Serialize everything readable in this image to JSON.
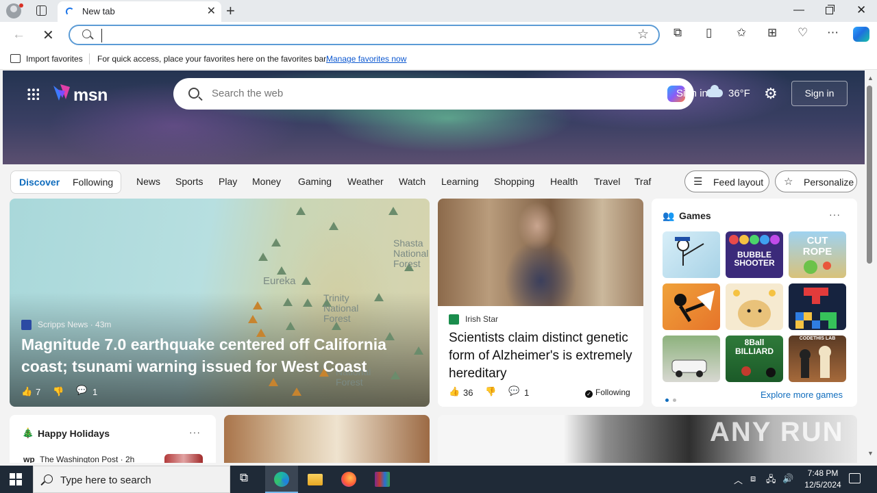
{
  "browser": {
    "tab_title": "New tab",
    "address_value": "",
    "favorites_bar": {
      "import_label": "Import favorites",
      "hint_text": "For quick access, place your favorites here on the favorites bar.",
      "manage_link": "Manage favorites now"
    }
  },
  "msn": {
    "logo_text": "msn",
    "search_placeholder": "Search the web",
    "signin_peek": "Sign in",
    "temperature": "36°F",
    "signin_button": "Sign in",
    "categories": {
      "discover": "Discover",
      "following": "Following",
      "items": [
        "News",
        "Sports",
        "Play",
        "Money",
        "Gaming",
        "Weather",
        "Watch",
        "Learning",
        "Shopping",
        "Health",
        "Travel",
        "Traf"
      ]
    },
    "feed_layout_label": "Feed layout",
    "personalize_label": "Personalize",
    "hero_story": {
      "source": "Scripps News · 43m",
      "title": "Magnitude 7.0 earthquake centered off California coast; tsunami warning issued for West Coast",
      "likes": "7",
      "comments": "1",
      "map_labels": [
        "Eureka",
        "Shasta\nNational\nForest",
        "Trinity\nNational\nForest",
        "National\nForest"
      ]
    },
    "second_story": {
      "source": "Irish Star",
      "title": "Scientists claim distinct genetic form of Alzheimer's is extremely hereditary",
      "likes": "36",
      "comments": "1",
      "following_label": "Following"
    },
    "games": {
      "title": "Games",
      "tiles": [
        "Thief Puzzle",
        "Bubble Shooter HD",
        "Cut the Rope",
        "Stickman",
        "Doge",
        "Blocks",
        "Rally",
        "8 Ball Billiard",
        "Chess"
      ],
      "tile_texts": {
        "bubble": "BUBBLE\nSHOOTER",
        "rope": "CUT\nROPE",
        "billiard": "8Ball\nBILLIARD",
        "codethis": "CODETHIS LAB"
      },
      "explore_label": "Explore more games"
    },
    "holidays": {
      "title": "Happy Holidays",
      "source": "The Washington Post · 2h"
    }
  },
  "watermark": "ANY RUN",
  "taskbar": {
    "search_placeholder": "Type here to search",
    "time": "7:48 PM",
    "date": "12/5/2024"
  }
}
